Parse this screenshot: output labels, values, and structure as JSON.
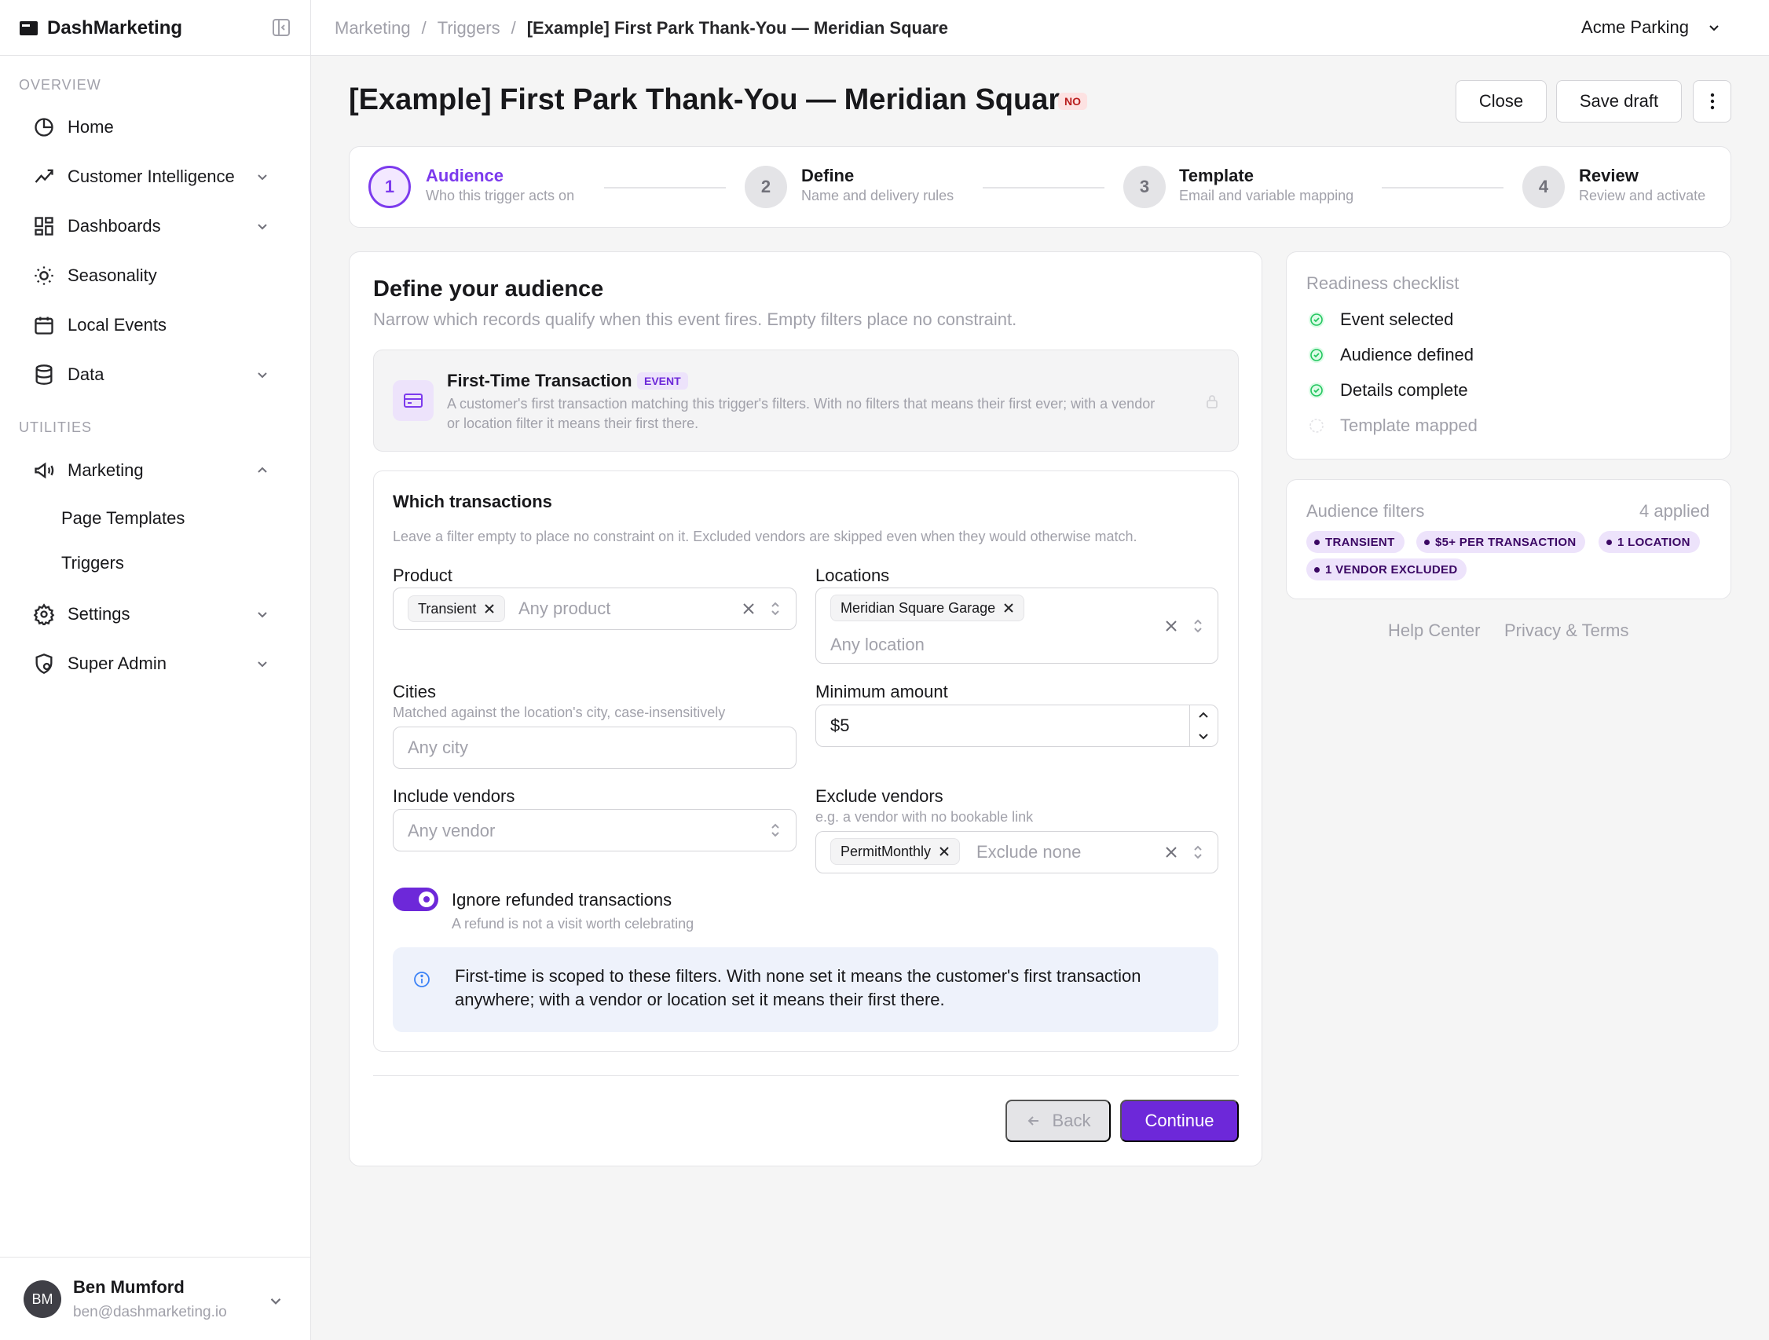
{
  "app": {
    "brand": "DashMarketing"
  },
  "sidebar": {
    "overview_label": "OVERVIEW",
    "utilities_label": "UTILITIES",
    "items": [
      {
        "label": "Home"
      },
      {
        "label": "Customer Intelligence"
      },
      {
        "label": "Dashboards"
      },
      {
        "label": "Seasonality"
      },
      {
        "label": "Local Events"
      },
      {
        "label": "Data"
      },
      {
        "label": "Marketing"
      },
      {
        "label": "Settings"
      },
      {
        "label": "Super Admin"
      }
    ],
    "sub_items": [
      {
        "label": "Page Templates"
      },
      {
        "label": "Triggers"
      }
    ],
    "user": {
      "initials": "BM",
      "name": "Ben Mumford",
      "email": "ben@dashmarketing.io"
    }
  },
  "topbar": {
    "breadcrumb": [
      "Marketing",
      "Triggers",
      "[Example] First Park Thank-You — Meridian Square"
    ],
    "separator": "/",
    "org": "Acme Parking"
  },
  "header": {
    "title": "[Example] First Park Thank-You — Meridian Square",
    "badge": "NO",
    "close_label": "Close",
    "save_label": "Save draft"
  },
  "steps": [
    {
      "num": "1",
      "title": "Audience",
      "sub": "Who this trigger acts on"
    },
    {
      "num": "2",
      "title": "Define",
      "sub": "Name and delivery rules"
    },
    {
      "num": "3",
      "title": "Template",
      "sub": "Email and variable mapping"
    },
    {
      "num": "4",
      "title": "Review",
      "sub": "Review and activate"
    }
  ],
  "audience": {
    "title": "Define your audience",
    "subtitle": "Narrow which records qualify when this event fires. Empty filters place no constraint.",
    "event": {
      "title": "First-Time Transaction",
      "badge": "EVENT",
      "description": "A customer's first transaction matching this trigger's filters. With no filters that means their first ever; with a vendor or location filter it means their first there."
    },
    "transactions": {
      "title": "Which transactions",
      "subtitle": "Leave a filter empty to place no constraint on it. Excluded vendors are skipped even when they would otherwise match.",
      "product": {
        "label": "Product",
        "chip": "Transient",
        "placeholder": "Any product"
      },
      "locations": {
        "label": "Locations",
        "chip": "Meridian Square Garage",
        "placeholder": "Any location"
      },
      "cities": {
        "label": "Cities",
        "hint": "Matched against the location's city, case-insensitively",
        "placeholder": "Any city"
      },
      "min_amount": {
        "label": "Minimum amount",
        "value": "$5"
      },
      "include_vendors": {
        "label": "Include vendors",
        "placeholder": "Any vendor"
      },
      "exclude_vendors": {
        "label": "Exclude vendors",
        "hint": "e.g. a vendor with no bookable link",
        "chip": "PermitMonthly",
        "placeholder": "Exclude none"
      },
      "refund_toggle": {
        "label": "Ignore refunded transactions",
        "hint": "A refund is not a visit worth celebrating",
        "on": true
      }
    },
    "info": "First-time is scoped to these filters. With none set it means the customer's first transaction anywhere; with a vendor or location set it means their first there.",
    "back_label": "Back",
    "continue_label": "Continue"
  },
  "checklist": {
    "title": "Readiness checklist",
    "items": [
      {
        "label": "Event selected",
        "done": true
      },
      {
        "label": "Audience defined",
        "done": true
      },
      {
        "label": "Details complete",
        "done": true
      },
      {
        "label": "Template mapped",
        "done": false
      }
    ]
  },
  "filters": {
    "title": "Audience filters",
    "count": "4 applied",
    "tags": [
      "TRANSIENT",
      "$5+ PER TRANSACTION",
      "1 LOCATION",
      "1 VENDOR EXCLUDED"
    ]
  },
  "footer": {
    "help": "Help Center",
    "privacy": "Privacy & Terms"
  },
  "colors": {
    "accent": "#6d28d9",
    "success": "#22c55e",
    "danger_badge": "#fde2e2"
  }
}
